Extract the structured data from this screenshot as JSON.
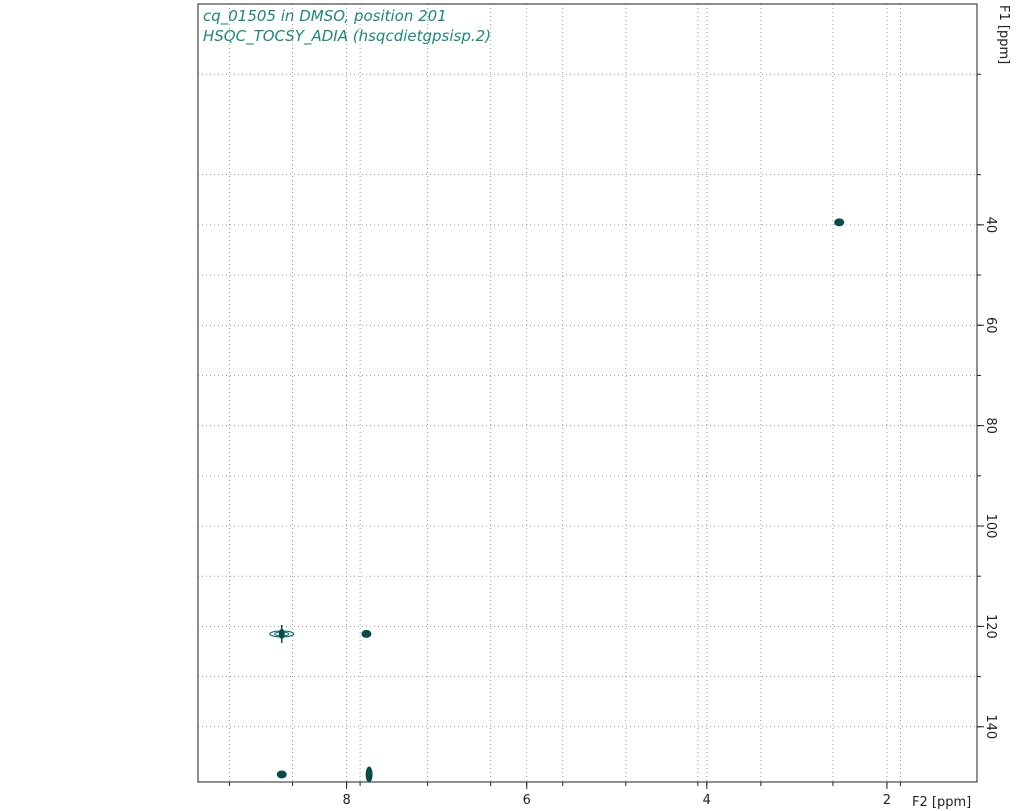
{
  "chart_data": {
    "type": "scatter",
    "title_lines": [
      "cq_01505 in DMSO, position 201",
      "HSQC_TOCSY_ADIA (hsqcdietgpsisp.2)"
    ],
    "xlabel": "F2 [ppm]",
    "ylabel": "F1 [ppm]",
    "xlim": [
      9.65,
      1.0
    ],
    "ylim": [
      -4,
      151
    ],
    "x_ticks": [
      8,
      6,
      4,
      2
    ],
    "x_gridlines": [
      9.3,
      8.6,
      7.85,
      7.1,
      6.4,
      5.6,
      4.9,
      4.1,
      3.4,
      2.6,
      1.85
    ],
    "y_ticks": [
      40,
      60,
      80,
      100,
      120,
      140
    ],
    "y_gridlines": [
      10,
      30,
      50,
      70,
      90,
      110,
      130
    ],
    "grid": true,
    "peaks": [
      {
        "x": 2.53,
        "y": 39.5,
        "shape": "dot"
      },
      {
        "x": 8.72,
        "y": 121.5,
        "shape": "cross"
      },
      {
        "x": 7.78,
        "y": 121.5,
        "shape": "dot"
      },
      {
        "x": 8.72,
        "y": 149.5,
        "shape": "dot"
      },
      {
        "x": 7.75,
        "y": 149.5,
        "shape": "vdot"
      }
    ],
    "colors": {
      "peak": "#0b4a4a",
      "peak_outline": "#0f6e6e",
      "title": "#1a8a76",
      "grid": "#9a9a9a",
      "axis": "#222222"
    }
  }
}
